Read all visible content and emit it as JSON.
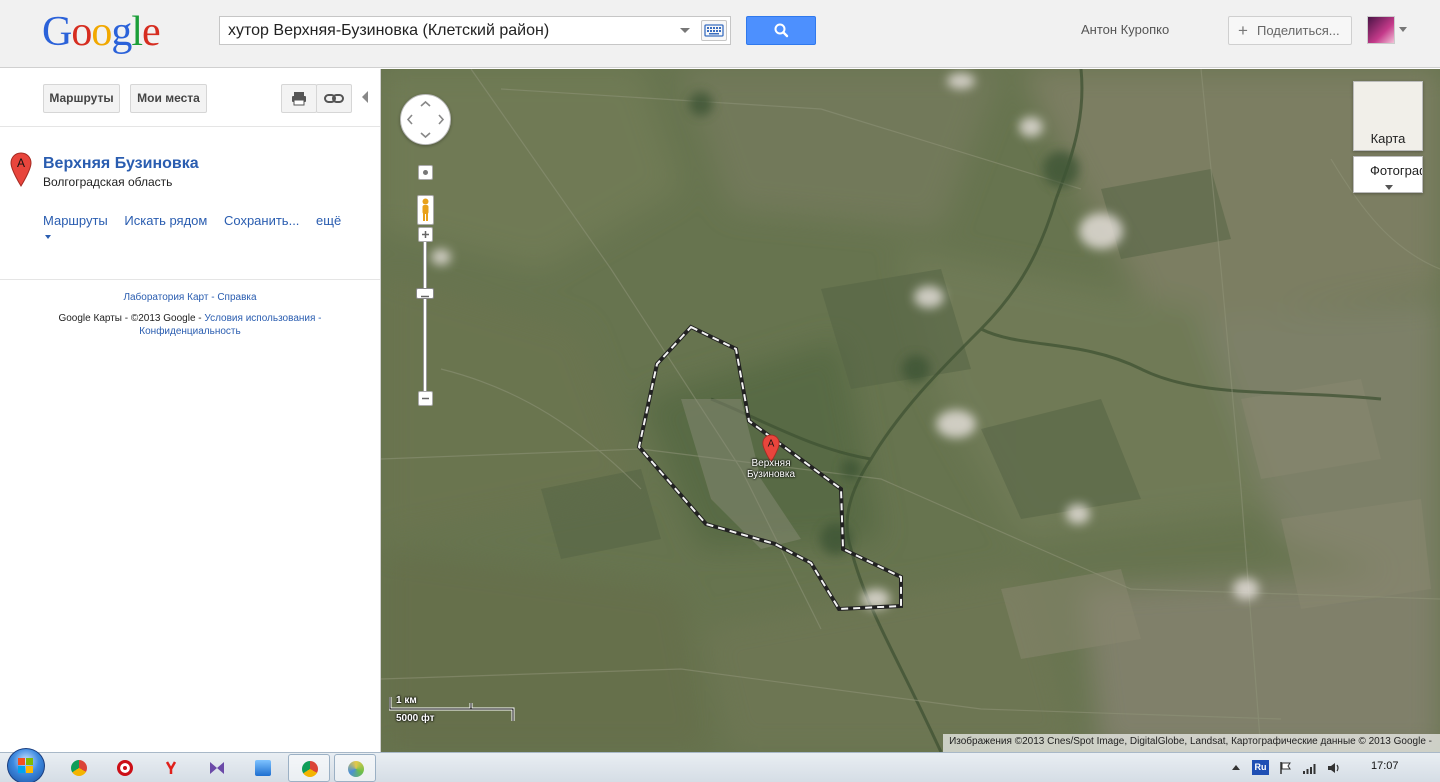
{
  "header": {
    "logo": "Google",
    "search_value": "хутор Верхняя-Бузиновка (Клетский район)",
    "user_name": "Антон Куропко",
    "share_label": "Поделиться..."
  },
  "left_panel": {
    "toolbar": {
      "routes_label": "Маршруты",
      "my_places_label": "Мои места"
    },
    "result": {
      "marker_letter": "A",
      "title": "Верхняя Бузиновка",
      "subtitle": "Волгоградская область",
      "actions": {
        "routes": "Маршруты",
        "search_nearby": "Искать рядом",
        "save": "Сохранить...",
        "more": "ещё"
      }
    },
    "footer": {
      "labs": "Лаборатория Карт",
      "sep1": " - ",
      "help": "Справка",
      "copyright": "Google Карты - ©2013 Google - ",
      "terms": "Условия использования",
      "sep2": " -",
      "privacy": "Конфиденциальность"
    }
  },
  "map": {
    "map_type_map": "Карта",
    "map_type_satellite": "Фотография",
    "marker_letter": "A",
    "place_label_line1": "Верхняя",
    "place_label_line2": "Бузиновка",
    "scale_metric": "1 км",
    "scale_imperial": "5000 фт",
    "attribution": "Изображения ©2013 Cnes/Spot Image, DigitalGlobe, Landsat, Картографические данные © 2013 Google -"
  },
  "taskbar": {
    "language": "Ru",
    "clock": "17:07"
  },
  "icons": {
    "search": "search-icon",
    "keyboard": "keyboard-icon",
    "print": "printer-icon",
    "link": "link-icon",
    "marker": "map-marker-icon",
    "pegman": "pegman-icon"
  },
  "colors": {
    "accent": "#4d90fe",
    "link": "#2a5db0",
    "marker": "#e8453c"
  }
}
